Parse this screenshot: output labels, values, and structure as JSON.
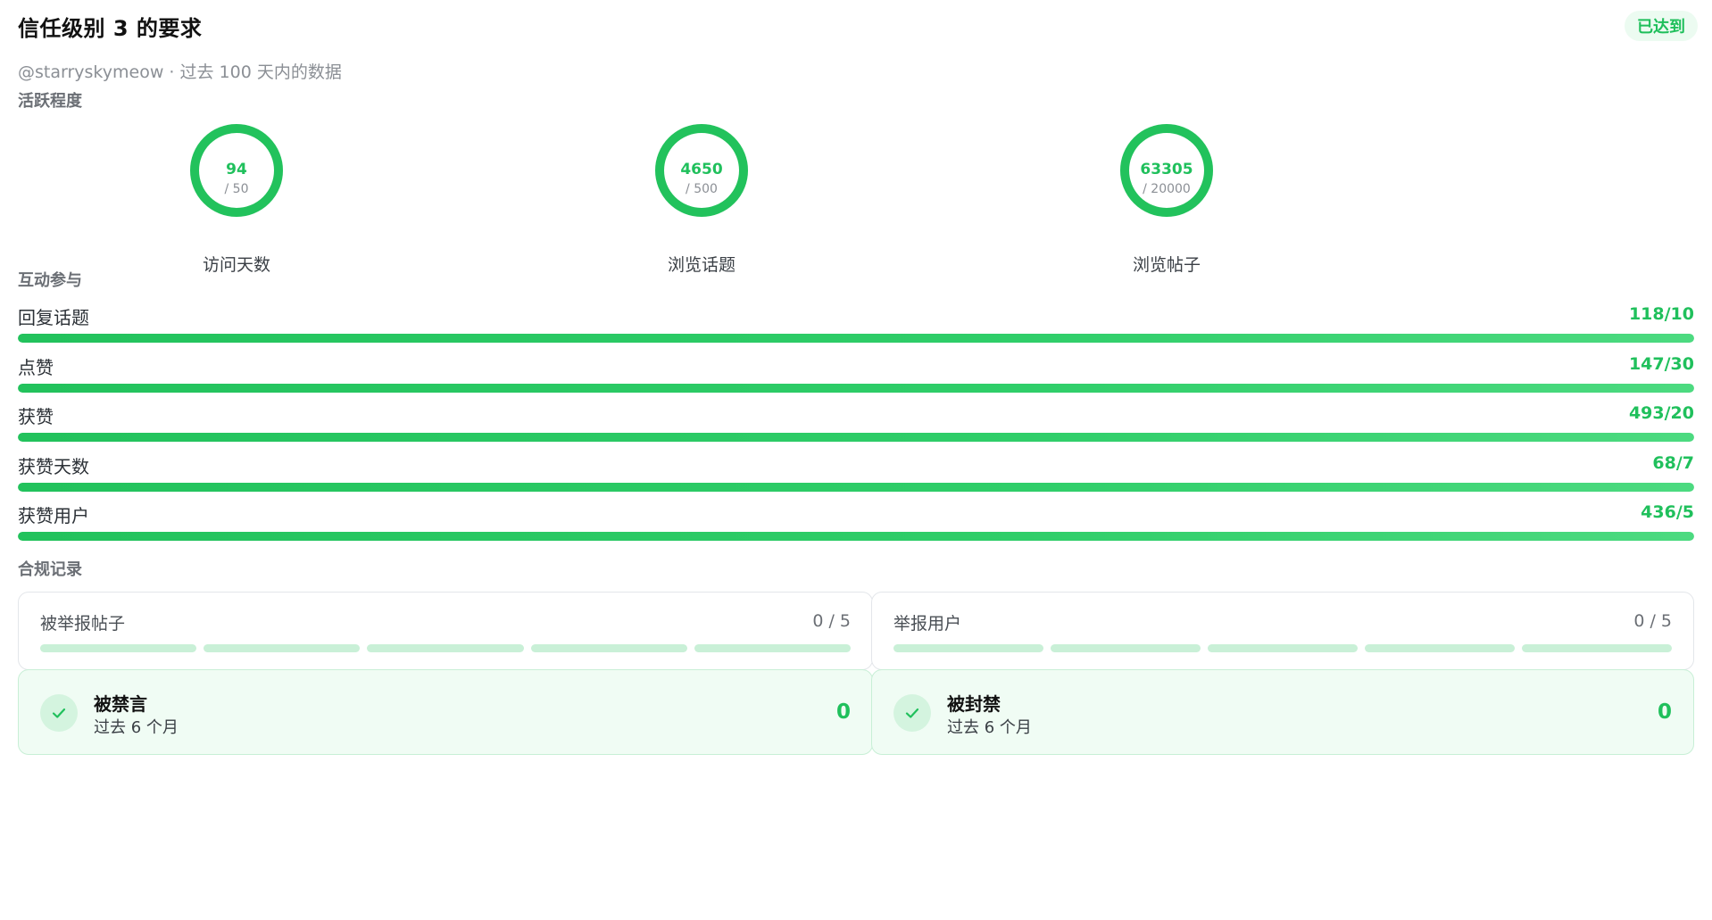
{
  "header": {
    "title": "信任级别 3 的要求",
    "subtitle": "@starryskymeow · 过去 100 天内的数据",
    "badge": "已达到"
  },
  "colors": {
    "accent": "#20c05c",
    "accent_light": "#ecfbf1",
    "track_light": "#c9f0d7",
    "muted_text": "#8b8f95"
  },
  "activity": {
    "section_label": "活跃程度",
    "gauges": [
      {
        "value": "94",
        "target": "/ 50",
        "label": "访问天数",
        "progress": 1.0
      },
      {
        "value": "4650",
        "target": "/ 500",
        "label": "浏览话题",
        "progress": 1.0
      },
      {
        "value": "63305",
        "target": "/ 20000",
        "label": "浏览帖子",
        "progress": 1.0
      }
    ]
  },
  "engagement": {
    "section_label": "互动参与",
    "metrics": [
      {
        "label": "回复话题",
        "value": "118/10",
        "progress": 1.0
      },
      {
        "label": "点赞",
        "value": "147/30",
        "progress": 1.0
      },
      {
        "label": "获赞",
        "value": "493/20",
        "progress": 1.0
      },
      {
        "label": "获赞天数",
        "value": "68/7",
        "progress": 1.0
      },
      {
        "label": "获赞用户",
        "value": "436/5",
        "progress": 1.0
      }
    ]
  },
  "compliance": {
    "section_label": "合规记录",
    "cards": [
      {
        "label": "被举报帖子",
        "value": "0 / 5",
        "segments": 5
      },
      {
        "label": "举报用户",
        "value": "0 / 5",
        "segments": 5
      }
    ],
    "statuses": [
      {
        "title": "被禁言",
        "subtitle": "过去 6 个月",
        "value": "0",
        "icon": "check-icon"
      },
      {
        "title": "被封禁",
        "subtitle": "过去 6 个月",
        "value": "0",
        "icon": "check-icon"
      }
    ]
  }
}
